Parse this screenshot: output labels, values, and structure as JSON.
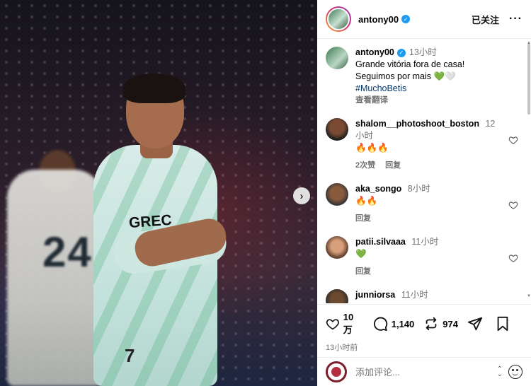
{
  "post": {
    "username": "antony00",
    "follow_label": "已关注",
    "more_label": "···",
    "caption": {
      "username": "antony00",
      "time": "13小时",
      "line1": "Grande vitória fora de casa!",
      "line2": "Seguimos por mais 💚🤍",
      "hashtag": "#MuchoBetis",
      "translate": "查看翻译"
    },
    "photo": {
      "sponsor_text": "GREC",
      "back_number": "24",
      "shorts_number": "7"
    },
    "next_label": "›"
  },
  "comments": [
    {
      "username": "shalom__photoshoot_boston",
      "time": "12小时",
      "text": "🔥🔥🔥",
      "likes": "2次赞",
      "reply": "回复"
    },
    {
      "username": "aka_songo",
      "time": "8小时",
      "text": "🔥🔥",
      "reply": "回复"
    },
    {
      "username": "patii.silvaaa",
      "time": "11小时",
      "text": "💚",
      "reply": "回复"
    },
    {
      "username": "junniorsa",
      "time": "11小时"
    }
  ],
  "actions": {
    "likes": "10 万",
    "comments": "1,140",
    "reposts": "974",
    "date": "13小时前"
  },
  "add_comment": {
    "placeholder": "添加评论..."
  }
}
